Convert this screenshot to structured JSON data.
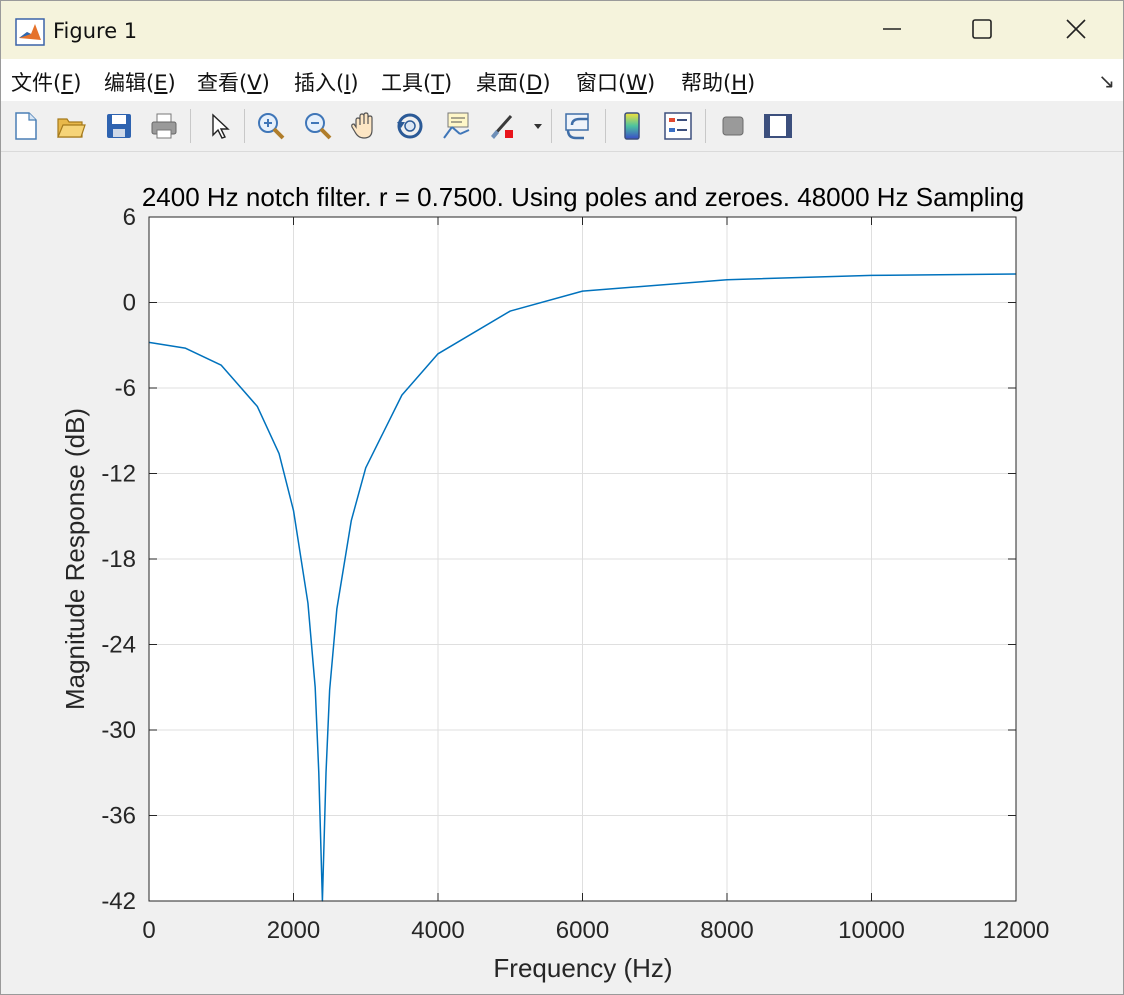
{
  "window": {
    "title": "Figure 1"
  },
  "menu": [
    {
      "pre": "文件(",
      "acc": "F",
      "post": ")"
    },
    {
      "pre": "编辑(",
      "acc": "E",
      "post": ")"
    },
    {
      "pre": "查看(",
      "acc": "V",
      "post": ")"
    },
    {
      "pre": "插入(",
      "acc": "I",
      "post": ")"
    },
    {
      "pre": "工具(",
      "acc": "T",
      "post": ")"
    },
    {
      "pre": "桌面(",
      "acc": "D",
      "post": ")"
    },
    {
      "pre": "窗口(",
      "acc": "W",
      "post": ")"
    },
    {
      "pre": "帮助(",
      "acc": "H",
      "post": ")"
    }
  ],
  "toolbar_icons": [
    "new-figure-icon",
    "open-file-icon",
    "save-icon",
    "print-icon",
    "select-arrow-icon",
    "zoom-in-icon",
    "zoom-out-icon",
    "pan-hand-icon",
    "rotate-3d-icon",
    "data-cursor-icon",
    "brush-icon",
    "link-plot-icon",
    "colorbar-icon",
    "legend-icon",
    "hide-plot-tools-icon",
    "show-plot-tools-icon"
  ],
  "colors": {
    "line": "#0072bd",
    "grid": "#dfdfdf",
    "titlebar": "#f5f3dc"
  },
  "chart_data": {
    "type": "line",
    "title": "2400 Hz notch filter. r = 0.7500. Using poles and zeroes. 48000 Hz Sampling",
    "xlabel": "Frequency (Hz)",
    "ylabel": "Magnitude Response (dB)",
    "xlim": [
      0,
      12000
    ],
    "ylim": [
      -42,
      6
    ],
    "xticks": [
      0,
      2000,
      4000,
      6000,
      8000,
      10000,
      12000
    ],
    "yticks": [
      6,
      0,
      -6,
      -12,
      -18,
      -24,
      -30,
      -36,
      -42
    ],
    "grid": true,
    "notch_frequency": 2400,
    "r": 0.75,
    "sampling_rate": 48000,
    "x": [
      0,
      500,
      1000,
      1500,
      1800,
      2000,
      2200,
      2300,
      2350,
      2400,
      2450,
      2500,
      2600,
      2800,
      3000,
      3500,
      4000,
      5000,
      6000,
      8000,
      10000,
      12000
    ],
    "y": [
      -2.8,
      -3.2,
      -4.4,
      -7.3,
      -10.6,
      -14.6,
      -21.1,
      -27.0,
      -33.0,
      -42,
      -33.0,
      -27.2,
      -21.5,
      -15.3,
      -11.6,
      -6.5,
      -3.6,
      -0.6,
      0.8,
      1.6,
      1.9,
      2.0
    ]
  }
}
